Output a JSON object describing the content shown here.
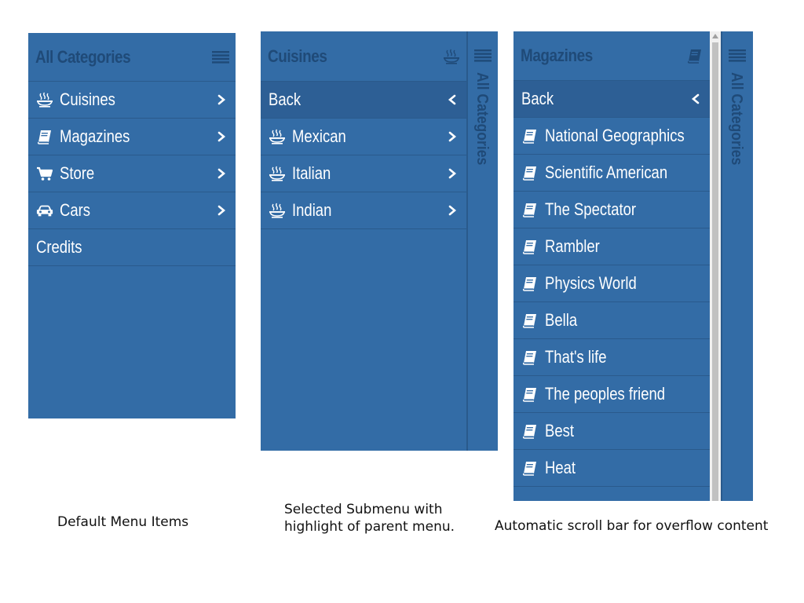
{
  "panel1": {
    "title": "All Categories",
    "header_icon": "hamburger-icon",
    "items": [
      {
        "label": "Cuisines",
        "icon": "food-icon",
        "has_submenu": true
      },
      {
        "label": "Magazines",
        "icon": "book-icon",
        "has_submenu": true
      },
      {
        "label": "Store",
        "icon": "cart-icon",
        "has_submenu": true
      },
      {
        "label": "Cars",
        "icon": "car-icon",
        "has_submenu": true
      },
      {
        "label": "Credits",
        "icon": "",
        "has_submenu": false
      }
    ],
    "caption": "Default Menu Items"
  },
  "panel2": {
    "title": "Cuisines",
    "header_icon": "food-icon",
    "back_label": "Back",
    "items": [
      {
        "label": "Mexican",
        "icon": "food-icon"
      },
      {
        "label": "Italian",
        "icon": "food-icon"
      },
      {
        "label": "Indian",
        "icon": "food-icon"
      }
    ],
    "parent_title": "All Categories",
    "caption_line1": "Selected Submenu with",
    "caption_line2": "highlight of parent menu."
  },
  "panel3": {
    "title": "Magazines",
    "header_icon": "book-icon",
    "back_label": "Back",
    "items": [
      {
        "label": "National Geographics",
        "icon": "book-icon"
      },
      {
        "label": "Scientific American",
        "icon": "book-icon"
      },
      {
        "label": "The Spectator",
        "icon": "book-icon"
      },
      {
        "label": "Rambler",
        "icon": "book-icon"
      },
      {
        "label": "Physics World",
        "icon": "book-icon"
      },
      {
        "label": "Bella",
        "icon": "book-icon"
      },
      {
        "label": "That's life",
        "icon": "book-icon"
      },
      {
        "label": "The peoples friend",
        "icon": "book-icon"
      },
      {
        "label": "Best",
        "icon": "book-icon"
      },
      {
        "label": "Heat",
        "icon": "book-icon"
      }
    ],
    "parent_title": "All Categories",
    "caption": "Automatic scroll bar for overflow content"
  },
  "colors": {
    "panel_bg": "#336ca6",
    "title_color": "#1f4a78",
    "divider": "#2a5a8c",
    "back_bg": "#2d5f95",
    "text": "#ffffff"
  }
}
